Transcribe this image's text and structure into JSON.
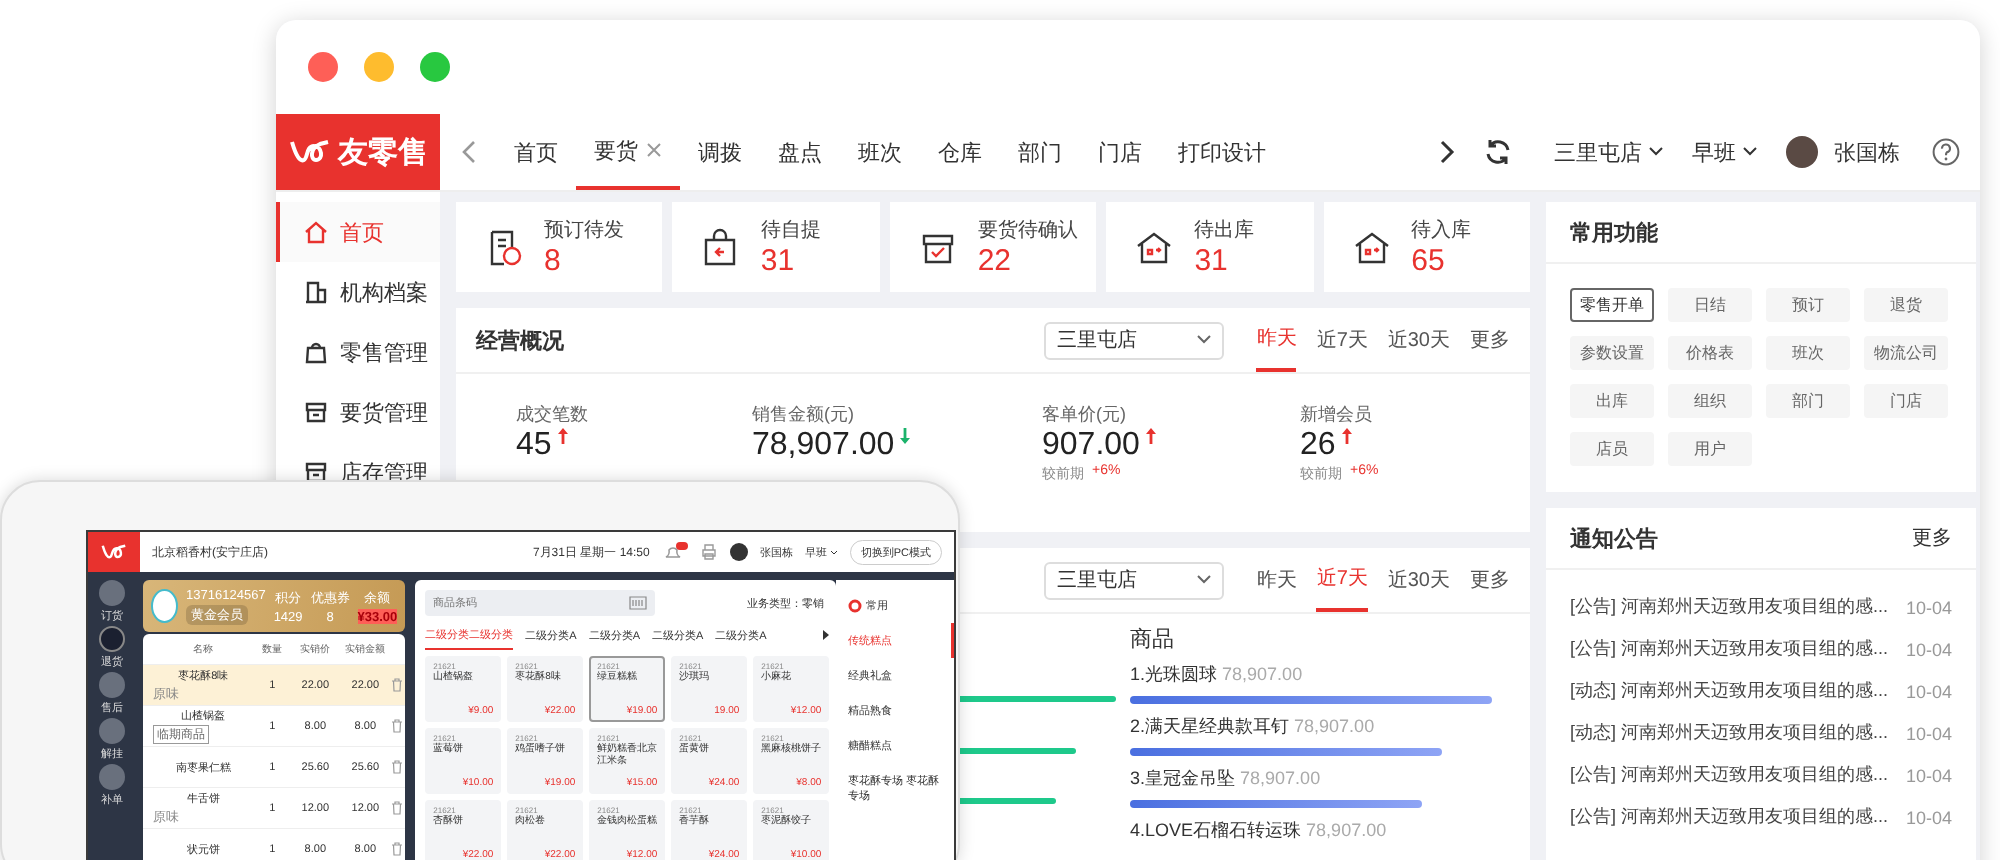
{
  "header": {
    "logo": "友零售",
    "tabs": [
      {
        "label": "首页",
        "selected": false,
        "closable": false
      },
      {
        "label": "要货",
        "selected": true,
        "closable": true
      },
      {
        "label": "调拨",
        "selected": false,
        "closable": false
      },
      {
        "label": "盘点",
        "selected": false,
        "closable": false
      },
      {
        "label": "班次",
        "selected": false,
        "closable": false
      },
      {
        "label": "仓库",
        "selected": false,
        "closable": false
      },
      {
        "label": "部门",
        "selected": false,
        "closable": false
      },
      {
        "label": "门店",
        "selected": false,
        "closable": false
      },
      {
        "label": "打印设计",
        "selected": false,
        "closable": false
      }
    ],
    "store": "三里屯店",
    "shift": "早班",
    "user": "张国栋"
  },
  "sidebar": {
    "items": [
      {
        "label": "首页",
        "selected": true
      },
      {
        "label": "机构档案",
        "selected": false
      },
      {
        "label": "零售管理",
        "selected": false
      },
      {
        "label": "要货管理",
        "selected": false
      },
      {
        "label": "店存管理",
        "selected": false
      }
    ]
  },
  "stat_cards": [
    {
      "label": "预订待发",
      "value": "8"
    },
    {
      "label": "待自提",
      "value": "31"
    },
    {
      "label": "要货待确认",
      "value": "22"
    },
    {
      "label": "待出库",
      "value": "31"
    },
    {
      "label": "待入库",
      "value": "65"
    }
  ],
  "overview": {
    "title": "经营概况",
    "store": "三里屯店",
    "ranges": [
      {
        "label": "昨天",
        "selected": true
      },
      {
        "label": "近7天",
        "selected": false
      },
      {
        "label": "近30天",
        "selected": false
      },
      {
        "label": "更多",
        "selected": false
      }
    ],
    "metrics": [
      {
        "label": "成交笔数",
        "value": "45",
        "rising": true
      },
      {
        "label": "销售金额(元)",
        "value": "78,907.00",
        "rising": false
      },
      {
        "label": "客单价(元)",
        "value": "907.00",
        "rising": true,
        "compare_label": "较前期",
        "compare": "+6%"
      },
      {
        "label": "新增会员",
        "value": "26",
        "rising": true,
        "compare_label": "较前期",
        "compare": "+6%"
      }
    ]
  },
  "ranking": {
    "store": "三里屯店",
    "ranges": [
      {
        "label": "昨天",
        "selected": false
      },
      {
        "label": "近7天",
        "selected": true
      },
      {
        "label": "近30天",
        "selected": false
      },
      {
        "label": "更多",
        "selected": false
      }
    ],
    "title": "商品",
    "items": [
      {
        "name": "1.光珠圆球",
        "value": "78,907.00",
        "level": 0.95
      },
      {
        "name": "2.满天星经典款耳钉",
        "value": "78,907.00",
        "level": 0.82
      },
      {
        "name": "3.皇冠金吊坠",
        "value": "78,907.00",
        "level": 0.77
      },
      {
        "name": "4.LOVE石榴石转运珠",
        "value": "78,907.00"
      }
    ]
  },
  "quick_functions": {
    "title": "常用功能",
    "items": [
      {
        "label": "零售开单",
        "selected": true
      },
      {
        "label": "日结",
        "selected": false
      },
      {
        "label": "预订",
        "selected": false
      },
      {
        "label": "退货",
        "selected": false
      },
      {
        "label": "参数设置",
        "selected": false
      },
      {
        "label": "价格表",
        "selected": false
      },
      {
        "label": "班次",
        "selected": false
      },
      {
        "label": "物流公司",
        "selected": false
      },
      {
        "label": "出库",
        "selected": false
      },
      {
        "label": "组织",
        "selected": false
      },
      {
        "label": "部门",
        "selected": false
      },
      {
        "label": "门店",
        "selected": false
      },
      {
        "label": "店员",
        "selected": false
      },
      {
        "label": "用户",
        "selected": false
      }
    ]
  },
  "notices": {
    "title": "通知公告",
    "more": "更多",
    "items": [
      {
        "text": "[公告] 河南郑州天迈致用友项目组的感...",
        "date": "10-04"
      },
      {
        "text": "[公告] 河南郑州天迈致用友项目组的感...",
        "date": "10-04"
      },
      {
        "text": "[动态] 河南郑州天迈致用友项目组的感...",
        "date": "10-04"
      },
      {
        "text": "[动态] 河南郑州天迈致用友项目组的感...",
        "date": "10-04"
      },
      {
        "text": "[公告] 河南郑州天迈致用友项目组的感...",
        "date": "10-04"
      },
      {
        "text": "[公告] 河南郑州天迈致用友项目组的感...",
        "date": "10-04"
      }
    ]
  },
  "tablet": {
    "store_name": "北京稻香村(安宁庄店)",
    "datetime": "7月31日 星期一 14:50",
    "user": "张国栋",
    "shift": "早班",
    "mode_button": "切换到PC模式",
    "rail": [
      {
        "label": "订货",
        "selected": false
      },
      {
        "label": "退货",
        "selected": true
      },
      {
        "label": "售后",
        "selected": false
      },
      {
        "label": "解挂",
        "selected": false
      },
      {
        "label": "补单",
        "selected": false
      }
    ],
    "member": {
      "phone": "13716124567",
      "tag": "黄金会员",
      "stats": [
        {
          "label": "积分",
          "value": "1429"
        },
        {
          "label": "优惠券",
          "value": "8"
        },
        {
          "label": "余额",
          "value": "¥33.00"
        }
      ]
    },
    "cart": {
      "columns": [
        "名称",
        "数量",
        "实销价",
        "实销金额"
      ],
      "rows": [
        {
          "name": "枣花酥8味",
          "note": "原味",
          "qty": "1",
          "price": "22.00",
          "amount": "22.00",
          "selected": true
        },
        {
          "name": "山楂锅盔",
          "tag": "临期商品",
          "qty": "1",
          "price": "8.00",
          "amount": "8.00",
          "selected": false
        },
        {
          "name": "南枣果仁糕",
          "qty": "1",
          "price": "25.60",
          "amount": "25.60",
          "selected": false
        },
        {
          "name": "牛舌饼",
          "note": "原味",
          "qty": "1",
          "price": "12.00",
          "amount": "12.00",
          "selected": false
        },
        {
          "name": "状元饼",
          "qty": "1",
          "price": "8.00",
          "amount": "8.00",
          "selected": false
        }
      ]
    },
    "products": {
      "search_placeholder": "商品条码",
      "business_type": "业务类型：零销",
      "categories": [
        {
          "label": "二级分类二级分类",
          "selected": true
        },
        {
          "label": "二级分类A",
          "selected": false
        },
        {
          "label": "二级分类A",
          "selected": false
        },
        {
          "label": "二级分类A",
          "selected": false
        },
        {
          "label": "二级分类A",
          "selected": false
        }
      ],
      "items": [
        {
          "code": "21621",
          "name": "山楂锅盔",
          "price": "¥9.00",
          "selected": false
        },
        {
          "code": "21621",
          "name": "枣花酥8味",
          "price": "¥22.00",
          "selected": false
        },
        {
          "code": "21621",
          "name": "绿豆糕糕",
          "price": "¥19.00",
          "selected": true
        },
        {
          "code": "21621",
          "name": "沙琪玛",
          "price": "19.00",
          "selected": false
        },
        {
          "code": "21621",
          "name": "小麻花",
          "price": "¥12.00",
          "selected": false
        },
        {
          "code": "21621",
          "name": "蓝莓饼",
          "price": "¥10.00",
          "selected": false
        },
        {
          "code": "21621",
          "name": "鸡蛋嗜子饼",
          "price": "¥19.00",
          "selected": false
        },
        {
          "code": "21621",
          "name": "鲜奶糕香北京江米条",
          "price": "¥15.00",
          "selected": false
        },
        {
          "code": "21621",
          "name": "蛋黄饼",
          "price": "¥24.00",
          "selected": false
        },
        {
          "code": "21621",
          "name": "黑麻核桃饼子",
          "price": "¥8.00",
          "selected": false
        },
        {
          "code": "21621",
          "name": "杏酥饼",
          "price": "¥22.00",
          "selected": false
        },
        {
          "code": "21621",
          "name": "肉松卷",
          "price": "¥22.00",
          "selected": false
        },
        {
          "code": "21621",
          "name": "金钱肉松蛋糕",
          "price": "¥12.00",
          "selected": false
        },
        {
          "code": "21621",
          "name": "香芋酥",
          "price": "¥24.00",
          "selected": false
        },
        {
          "code": "21621",
          "name": "枣泥酥饺子",
          "price": "¥10.00",
          "selected": false
        }
      ]
    },
    "category_menu": [
      {
        "label": "常用",
        "kind": "favorite",
        "selected": false
      },
      {
        "label": "传统糕点",
        "kind": "category",
        "selected": true
      },
      {
        "label": "经典礼盒",
        "kind": "category",
        "selected": false
      },
      {
        "label": "精品熟食",
        "kind": "category",
        "selected": false
      },
      {
        "label": "糖醋糕点",
        "kind": "category",
        "selected": false
      },
      {
        "label": "枣花酥专场 枣花酥专场",
        "kind": "category",
        "selected": false
      }
    ]
  }
}
